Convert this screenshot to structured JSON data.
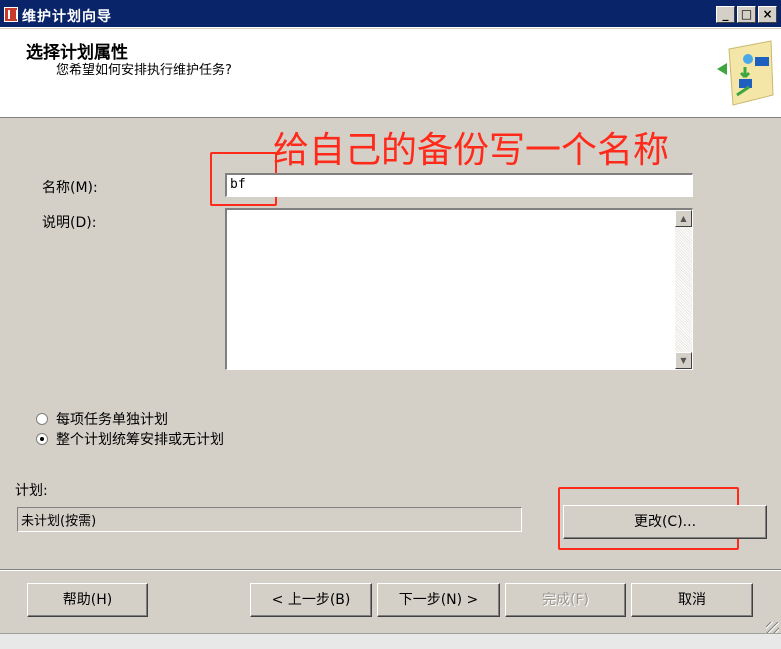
{
  "window": {
    "title": "维护计划向导"
  },
  "header": {
    "title": "选择计划属性",
    "subtitle": "您希望如何安排执行维护任务?"
  },
  "annotation": {
    "text": "给自己的备份写一个名称",
    "color": "#ff2a1a"
  },
  "form": {
    "name_label": "名称(M):",
    "name_value": "bf",
    "desc_label": "说明(D):",
    "desc_value": ""
  },
  "radios": [
    {
      "label": "每项任务单独计划",
      "selected": false
    },
    {
      "label": "整个计划统筹安排或无计划",
      "selected": true
    }
  ],
  "schedule": {
    "label": "计划:",
    "value": "未计划(按需)",
    "change_label": "更改(C)..."
  },
  "buttons": {
    "help": "帮助(H)",
    "back": "< 上一步(B)",
    "next": "下一步(N) >",
    "finish": "完成(F)",
    "cancel": "取消"
  },
  "icons": {
    "title_icon": "wizard-app-icon",
    "header_art": "maintenance-plan-art-icon"
  }
}
